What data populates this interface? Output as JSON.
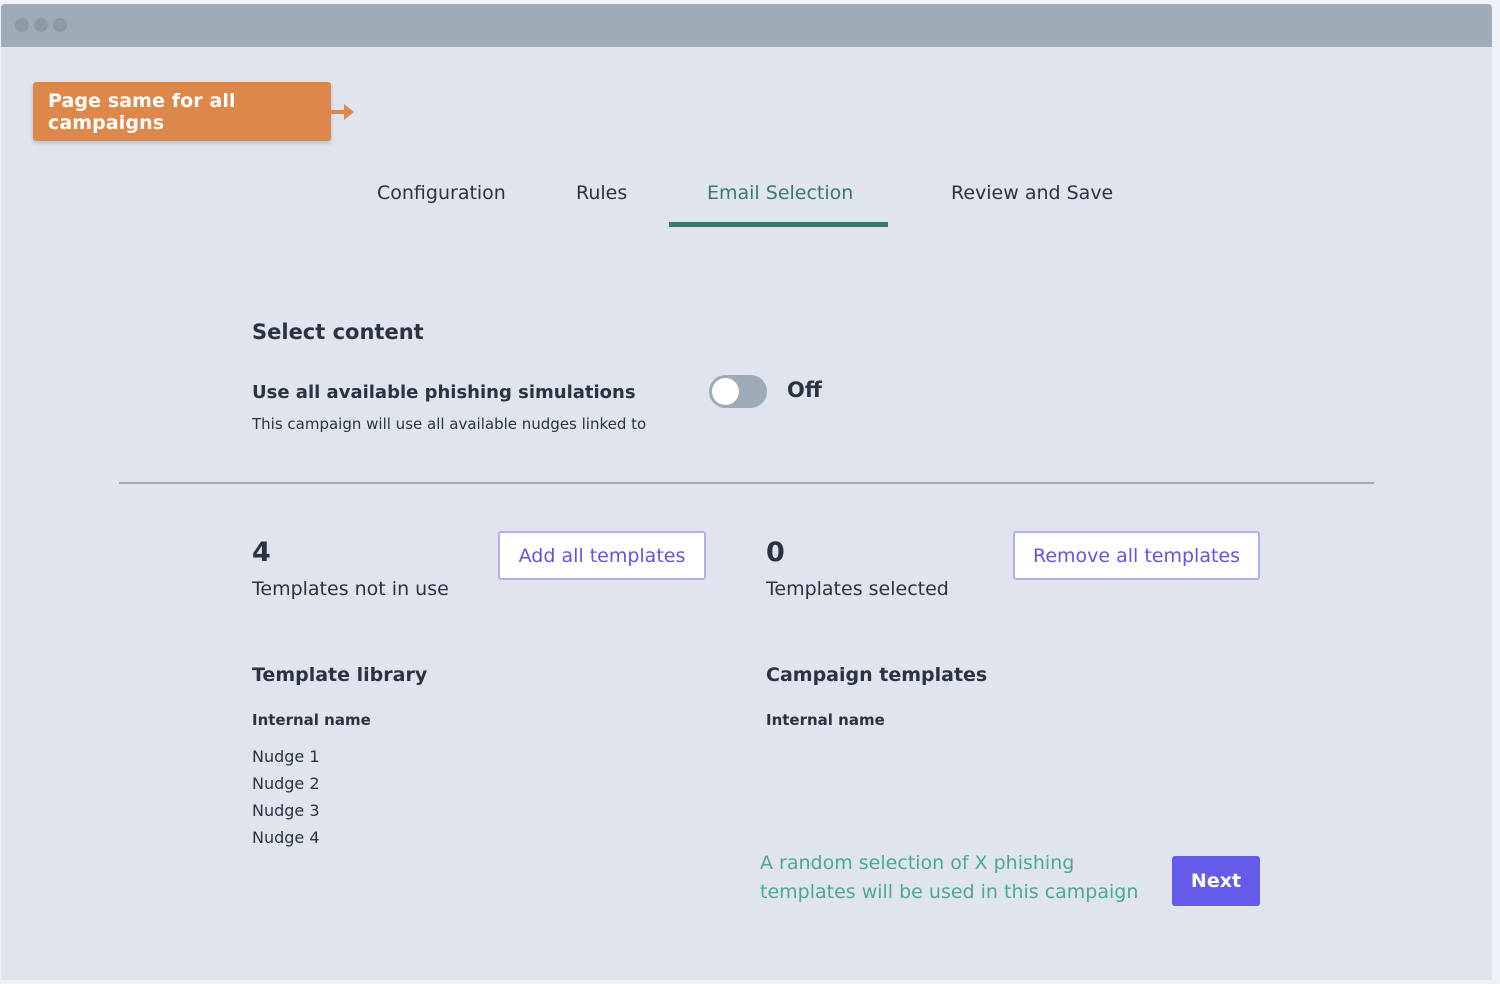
{
  "window": {
    "controls": [
      "close",
      "minimize",
      "maximize"
    ]
  },
  "callout": {
    "text": "Page same for all campaigns",
    "icon": "arrow-right-icon",
    "color": "#dd884a"
  },
  "tabs": [
    {
      "label": "Configuration",
      "active": false
    },
    {
      "label": "Rules",
      "active": false
    },
    {
      "label": "Email Selection",
      "active": true
    },
    {
      "label": "Review and Save",
      "active": false
    }
  ],
  "select_content": {
    "heading": "Select content",
    "option_label": "Use all available phishing simulations",
    "option_description": "This campaign will use all available nudges linked to",
    "toggle_on": false,
    "toggle_state_label": "Off"
  },
  "library": {
    "count": "4",
    "count_label": "Templates not in use",
    "button_label": "Add all templates",
    "title": "Template library",
    "column_header": "Internal name",
    "items": [
      "Nudge 1",
      "Nudge 2",
      "Nudge 3",
      "Nudge 4"
    ]
  },
  "campaign": {
    "count": "0",
    "count_label": "Templates selected",
    "button_label": "Remove all templates",
    "title": "Campaign templates",
    "column_header": "Internal name",
    "items": []
  },
  "footer": {
    "note_line1": "A random selection of X phishing",
    "note_line2": "templates will be used in this campaign",
    "next_label": "Next"
  },
  "colors": {
    "accent_tab": "#3b7a68",
    "primary": "#645bea",
    "note": "#4aa993",
    "background": "#e0e5ed",
    "titlebar": "#a0abb8"
  }
}
